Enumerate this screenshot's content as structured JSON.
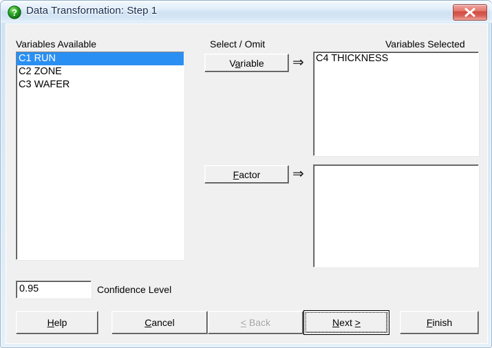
{
  "window": {
    "title": "Data Transformation: Step 1",
    "title_icon": "green-question-sphere-icon",
    "close_icon": "close-icon",
    "accent_title_color": "#12294d",
    "close_button_color": "#cf4b41",
    "selection_color": "#2a8ff2",
    "dialog_background": "#f0f0f0"
  },
  "panels": {
    "available": {
      "label": "Variables Available",
      "items": [
        {
          "text": "C1 RUN",
          "selected": true
        },
        {
          "text": "C2 ZONE",
          "selected": false
        },
        {
          "text": "C3 WAFER",
          "selected": false
        }
      ]
    },
    "middle": {
      "label": "Select / Omit",
      "variable_button": {
        "label": "Variable",
        "mnemonic": "a"
      },
      "factor_button": {
        "label": "Factor",
        "mnemonic": "F"
      },
      "arrow_glyph": "⇒"
    },
    "selected": {
      "label": "Variables Selected",
      "variable_items": [
        {
          "text": "C4 THICKNESS",
          "selected": false
        }
      ],
      "factor_items": []
    }
  },
  "confidence": {
    "value": "0.95",
    "label": "Confidence Level"
  },
  "footer": {
    "buttons": [
      {
        "pre": "",
        "mnemonic": "H",
        "post": "elp",
        "disabled": false,
        "default": false,
        "name": "help-button"
      },
      {
        "pre": "",
        "mnemonic": "C",
        "post": "ancel",
        "disabled": false,
        "default": false,
        "name": "cancel-button"
      },
      {
        "pre": "",
        "mnemonic": "<",
        "post": " Back",
        "disabled": true,
        "default": false,
        "name": "back-button"
      },
      {
        "pre": "",
        "mnemonic": "N",
        "post": "ext >",
        "disabled": false,
        "default": true,
        "name": "next-button"
      },
      {
        "pre": "",
        "mnemonic": "F",
        "post": "inish",
        "disabled": false,
        "default": false,
        "name": "finish-button"
      }
    ]
  }
}
